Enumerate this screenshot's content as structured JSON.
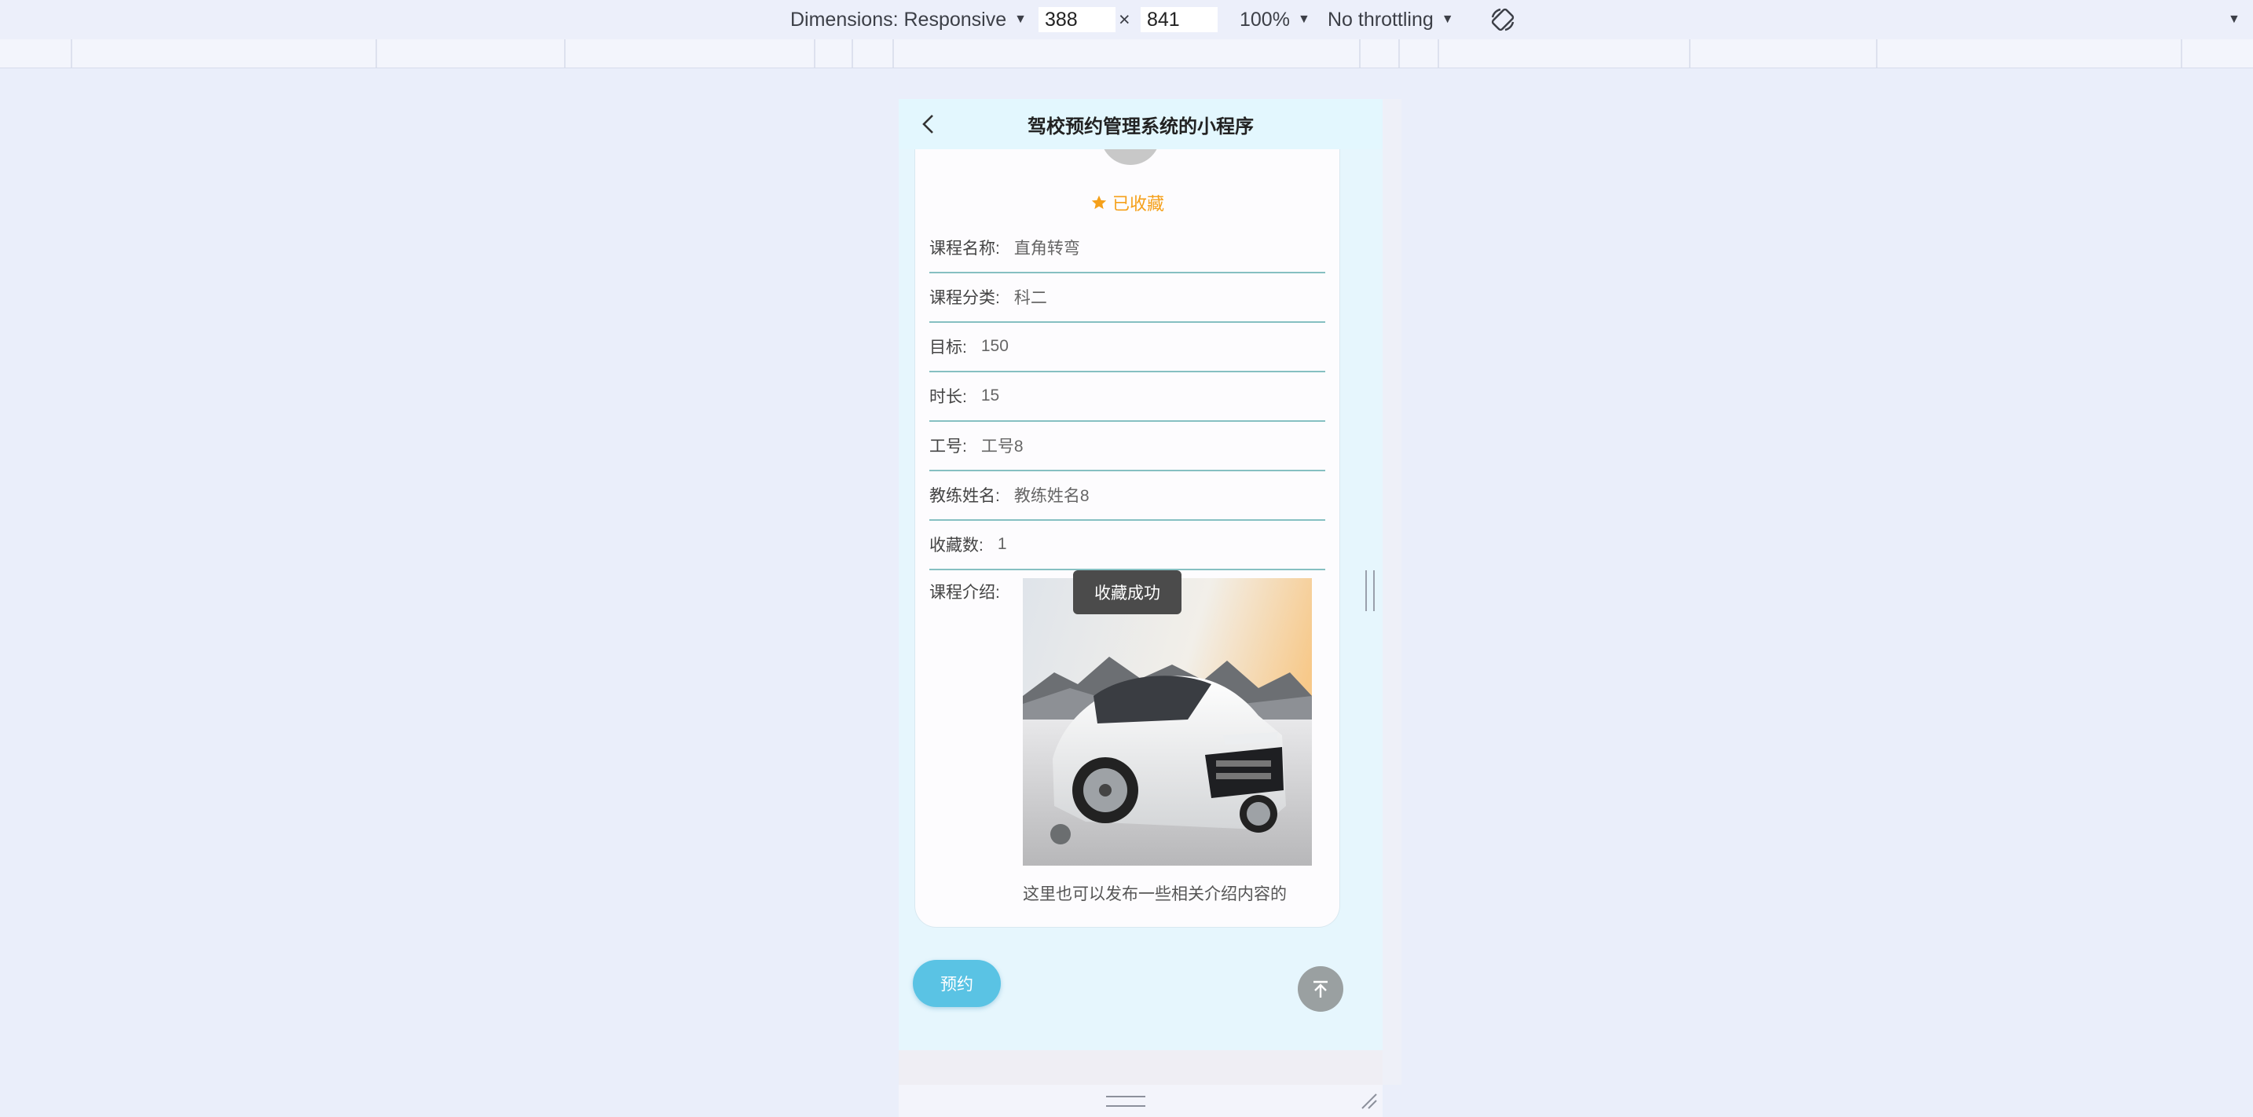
{
  "devtools": {
    "dimensions_label": "Dimensions: Responsive",
    "width_value": "388",
    "times": "×",
    "height_value": "841",
    "zoom": "100%",
    "throttling": "No throttling",
    "rotate_icon": "rotate-icon"
  },
  "app": {
    "title": "驾校预约管理系统的小程序",
    "back_icon": "chevron-left-icon"
  },
  "detail": {
    "favorite_label": "已收藏",
    "fields": [
      {
        "label": "课程名称:",
        "value": "直角转弯"
      },
      {
        "label": "课程分类:",
        "value": "科二"
      },
      {
        "label": "目标:",
        "value": "150"
      },
      {
        "label": "时长:",
        "value": "15"
      },
      {
        "label": "工号:",
        "value": "工号8"
      },
      {
        "label": "教练姓名:",
        "value": "教练姓名8"
      },
      {
        "label": "收藏数:",
        "value": "1"
      }
    ],
    "intro_label": "课程介绍:",
    "intro_text": "这里也可以发布一些相关介绍内容的"
  },
  "toast": "收藏成功",
  "actions": {
    "book_label": "预约",
    "top_icon": "arrow-up-to-top-icon"
  },
  "colors": {
    "accent": "#5ac3e4",
    "favorite": "#f5a01a",
    "divider": "#86c0c2"
  }
}
